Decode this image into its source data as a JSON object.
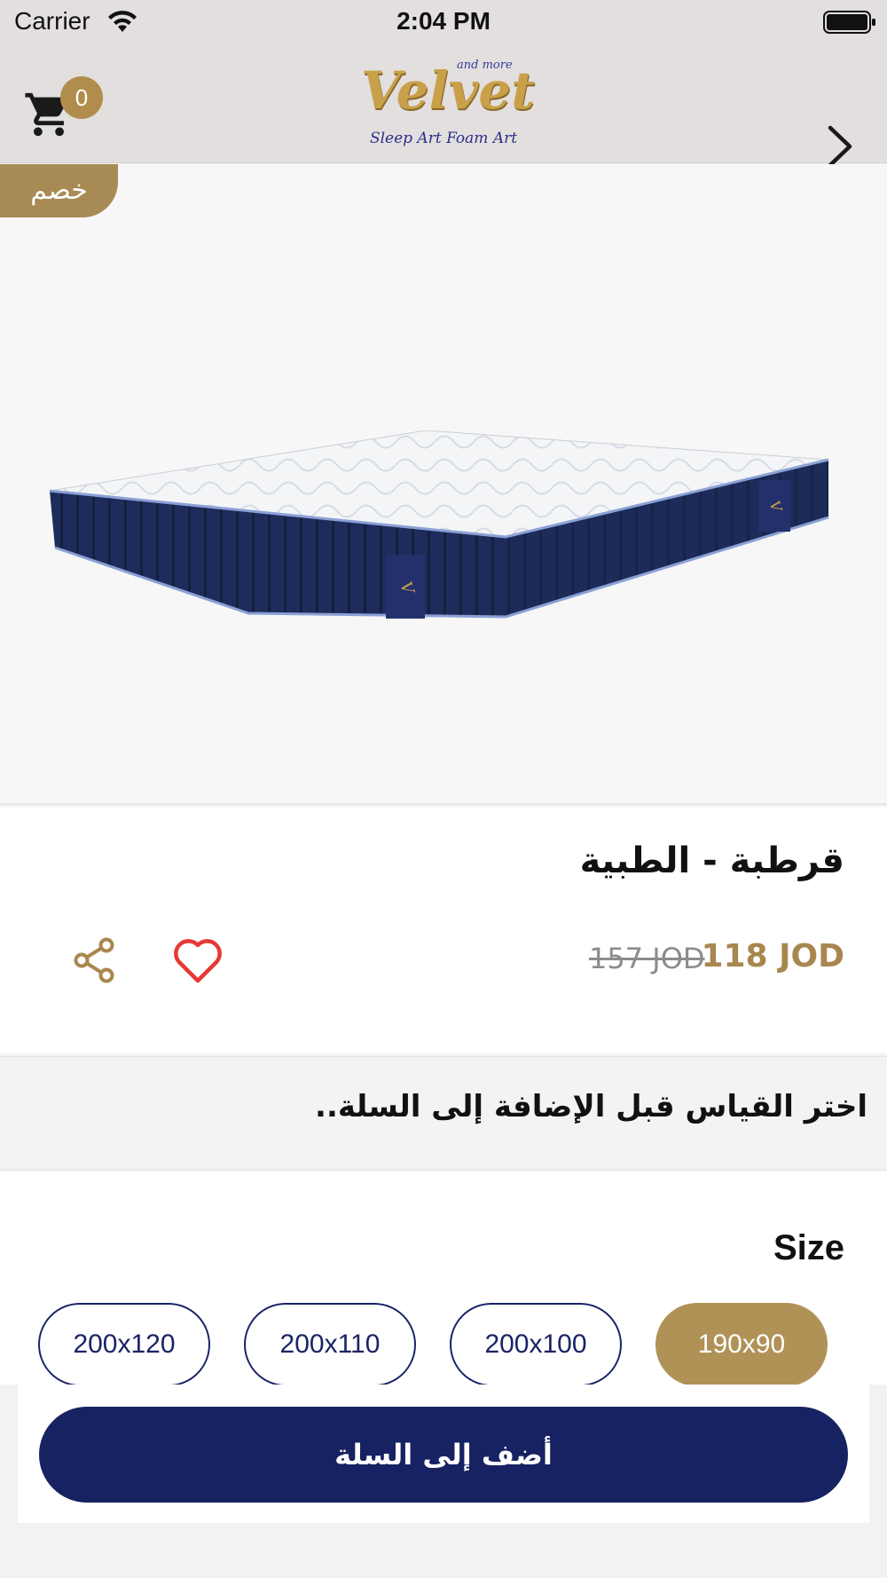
{
  "status_bar": {
    "carrier": "Carrier",
    "time": "2:04 PM"
  },
  "header": {
    "cart_count": "0",
    "logo_small": "and more",
    "logo_main": "Velvet",
    "logo_tagline": "Sleep Art Foam Art",
    "icons": [
      "cart-icon",
      "chevron-right-icon"
    ]
  },
  "product": {
    "discount_badge": "خصم",
    "title": "قرطبة - الطبية",
    "price_current": "118 JOD",
    "price_old": "157 JOD",
    "actions": [
      "share-icon",
      "heart-icon"
    ]
  },
  "notice": {
    "text": "اختر القياس قبل الإضافة إلى السلة.."
  },
  "size": {
    "label": "Size",
    "options": [
      {
        "label": "190x90",
        "selected": true
      },
      {
        "label": "200x100",
        "selected": false
      },
      {
        "label": "200x110",
        "selected": false
      },
      {
        "label": "200x120",
        "selected": false
      }
    ]
  },
  "cart_button": {
    "label": "أضف إلى السلة"
  },
  "colors": {
    "accent_gold": "#b09257",
    "primary_navy": "#162261",
    "heart_red": "#e53935"
  }
}
